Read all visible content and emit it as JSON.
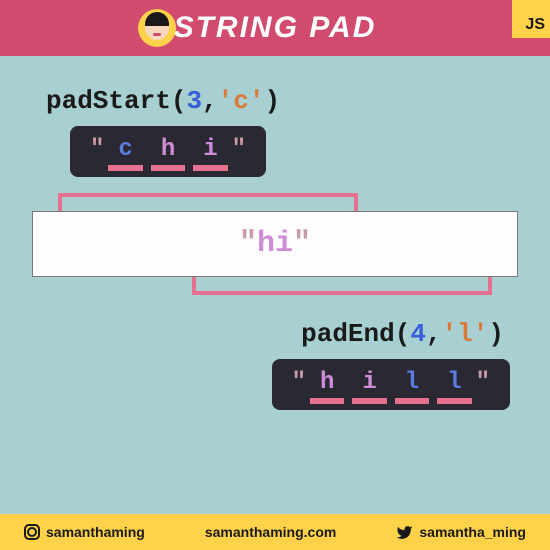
{
  "header": {
    "title": "STRING PAD",
    "badge": "JS"
  },
  "padStart": {
    "fn": "padStart",
    "arg_num": "3",
    "arg_str": "'c'",
    "result_chars": [
      {
        "c": "c",
        "cls": "blue"
      },
      {
        "c": "h",
        "cls": "mag"
      },
      {
        "c": "i",
        "cls": "mag"
      }
    ]
  },
  "center_string": "hi",
  "padEnd": {
    "fn": "padEnd",
    "arg_num": "4",
    "arg_str": "'l'",
    "result_chars": [
      {
        "c": "h",
        "cls": "mag"
      },
      {
        "c": "i",
        "cls": "mag"
      },
      {
        "c": "l",
        "cls": "blue"
      },
      {
        "c": "l",
        "cls": "blue"
      }
    ]
  },
  "footer": {
    "instagram": "samanthaming",
    "site": "samanthaming.com",
    "twitter": "samantha_ming"
  }
}
